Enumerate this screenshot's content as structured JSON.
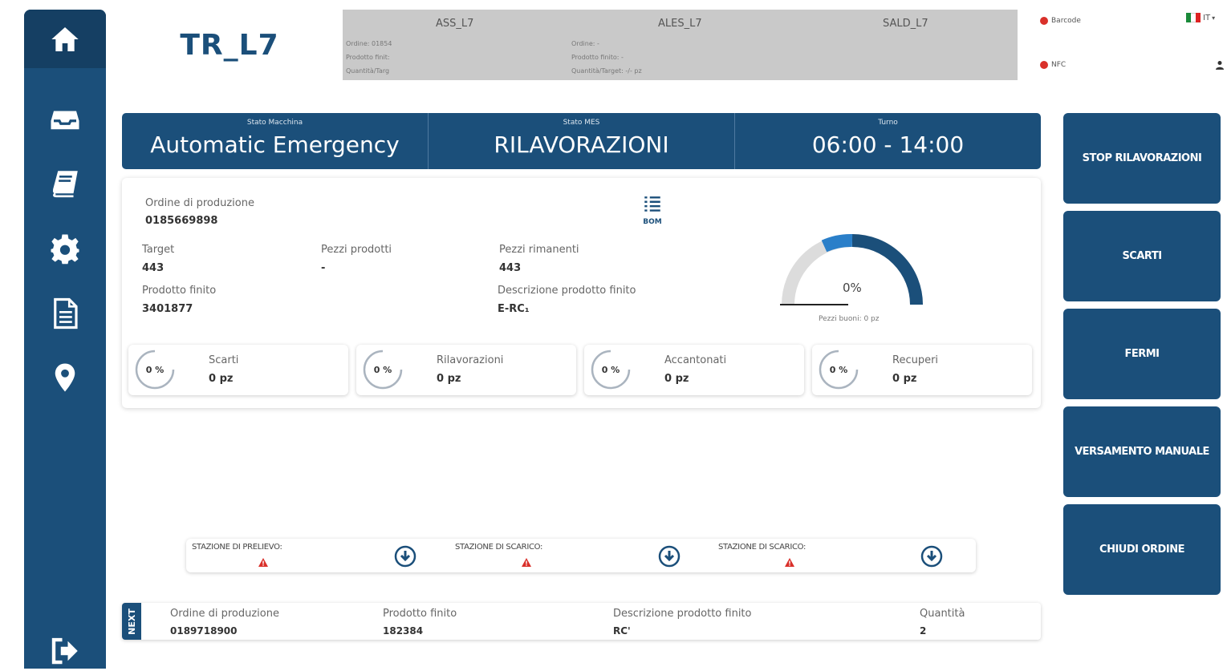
{
  "sidebar": {
    "items": [
      {
        "icon": "home-icon"
      },
      {
        "icon": "inbox-icon"
      },
      {
        "icon": "book-icon"
      },
      {
        "icon": "gear-icon"
      },
      {
        "icon": "document-icon"
      },
      {
        "icon": "location-pin-icon"
      },
      {
        "icon": "logout-icon"
      }
    ]
  },
  "header": {
    "line_title": "TR_L7",
    "stations": [
      {
        "name": "ASS_L7",
        "lines": [
          "Ordine: 01854",
          "Prodotto finit:",
          "Quantità/Targ"
        ]
      },
      {
        "name": "ALES_L7",
        "lines": [
          "Ordine: -",
          "Prodotto finito: -",
          "Quantità/Target: -/- pz"
        ]
      },
      {
        "name": "SALD_L7",
        "lines": []
      }
    ],
    "indicators": {
      "barcode": "Barcode",
      "nfc": "NFC"
    },
    "language": "IT"
  },
  "status": {
    "machine_label": "Stato Macchina",
    "machine_value": "Automatic Emergency",
    "mes_label": "Stato MES",
    "mes_value": "RILAVORAZIONI",
    "shift_label": "Turno",
    "shift_value": "06:00 - 14:00"
  },
  "order": {
    "order_label": "Ordine di produzione",
    "order_value": "0185669898",
    "bom_label": "BOM",
    "target_label": "Target",
    "target_value": "443",
    "produced_label": "Pezzi prodotti",
    "produced_value": "-",
    "remaining_label": "Pezzi rimanenti",
    "remaining_value": "443",
    "product_label": "Prodotto finito",
    "product_value": "3401877",
    "description_label": "Descrizione prodotto finito",
    "description_value": "E-RC₁",
    "gauge_value": "0%",
    "gauge_fraction": 0,
    "good_pieces": "Pezzi buoni: 0 pz"
  },
  "kpis": [
    {
      "label": "Scarti",
      "pct": "0 %",
      "value": "0 pz"
    },
    {
      "label": "Rilavorazioni",
      "pct": "0 %",
      "value": "0 pz"
    },
    {
      "label": "Accantonati",
      "pct": "0 %",
      "value": "0 pz"
    },
    {
      "label": "Recuperi",
      "pct": "0 %",
      "value": "0 pz"
    }
  ],
  "actions": [
    "STOP RILAVORAZIONI",
    "SCARTI",
    "FERMI",
    "VERSAMENTO MANUALE",
    "CHIUDI ORDINE"
  ],
  "stations_row": [
    {
      "label": "STAZIONE DI PRELIEVO:"
    },
    {
      "label": "STAZIONE DI SCARICO:"
    },
    {
      "label": "STAZIONE DI SCARICO:"
    }
  ],
  "next": {
    "tag": "NEXT",
    "order_label": "Ordine di produzione",
    "order_value": "0189718900",
    "product_label": "Prodotto finito",
    "product_value": "182384",
    "description_label": "Descrizione prodotto finito",
    "description_value": "RC'",
    "qty_label": "Quantità",
    "qty_value": "2"
  },
  "colors": {
    "primary": "#1b4f7a",
    "gauge_light": "#2a7fc9",
    "alert": "#d9302a"
  }
}
